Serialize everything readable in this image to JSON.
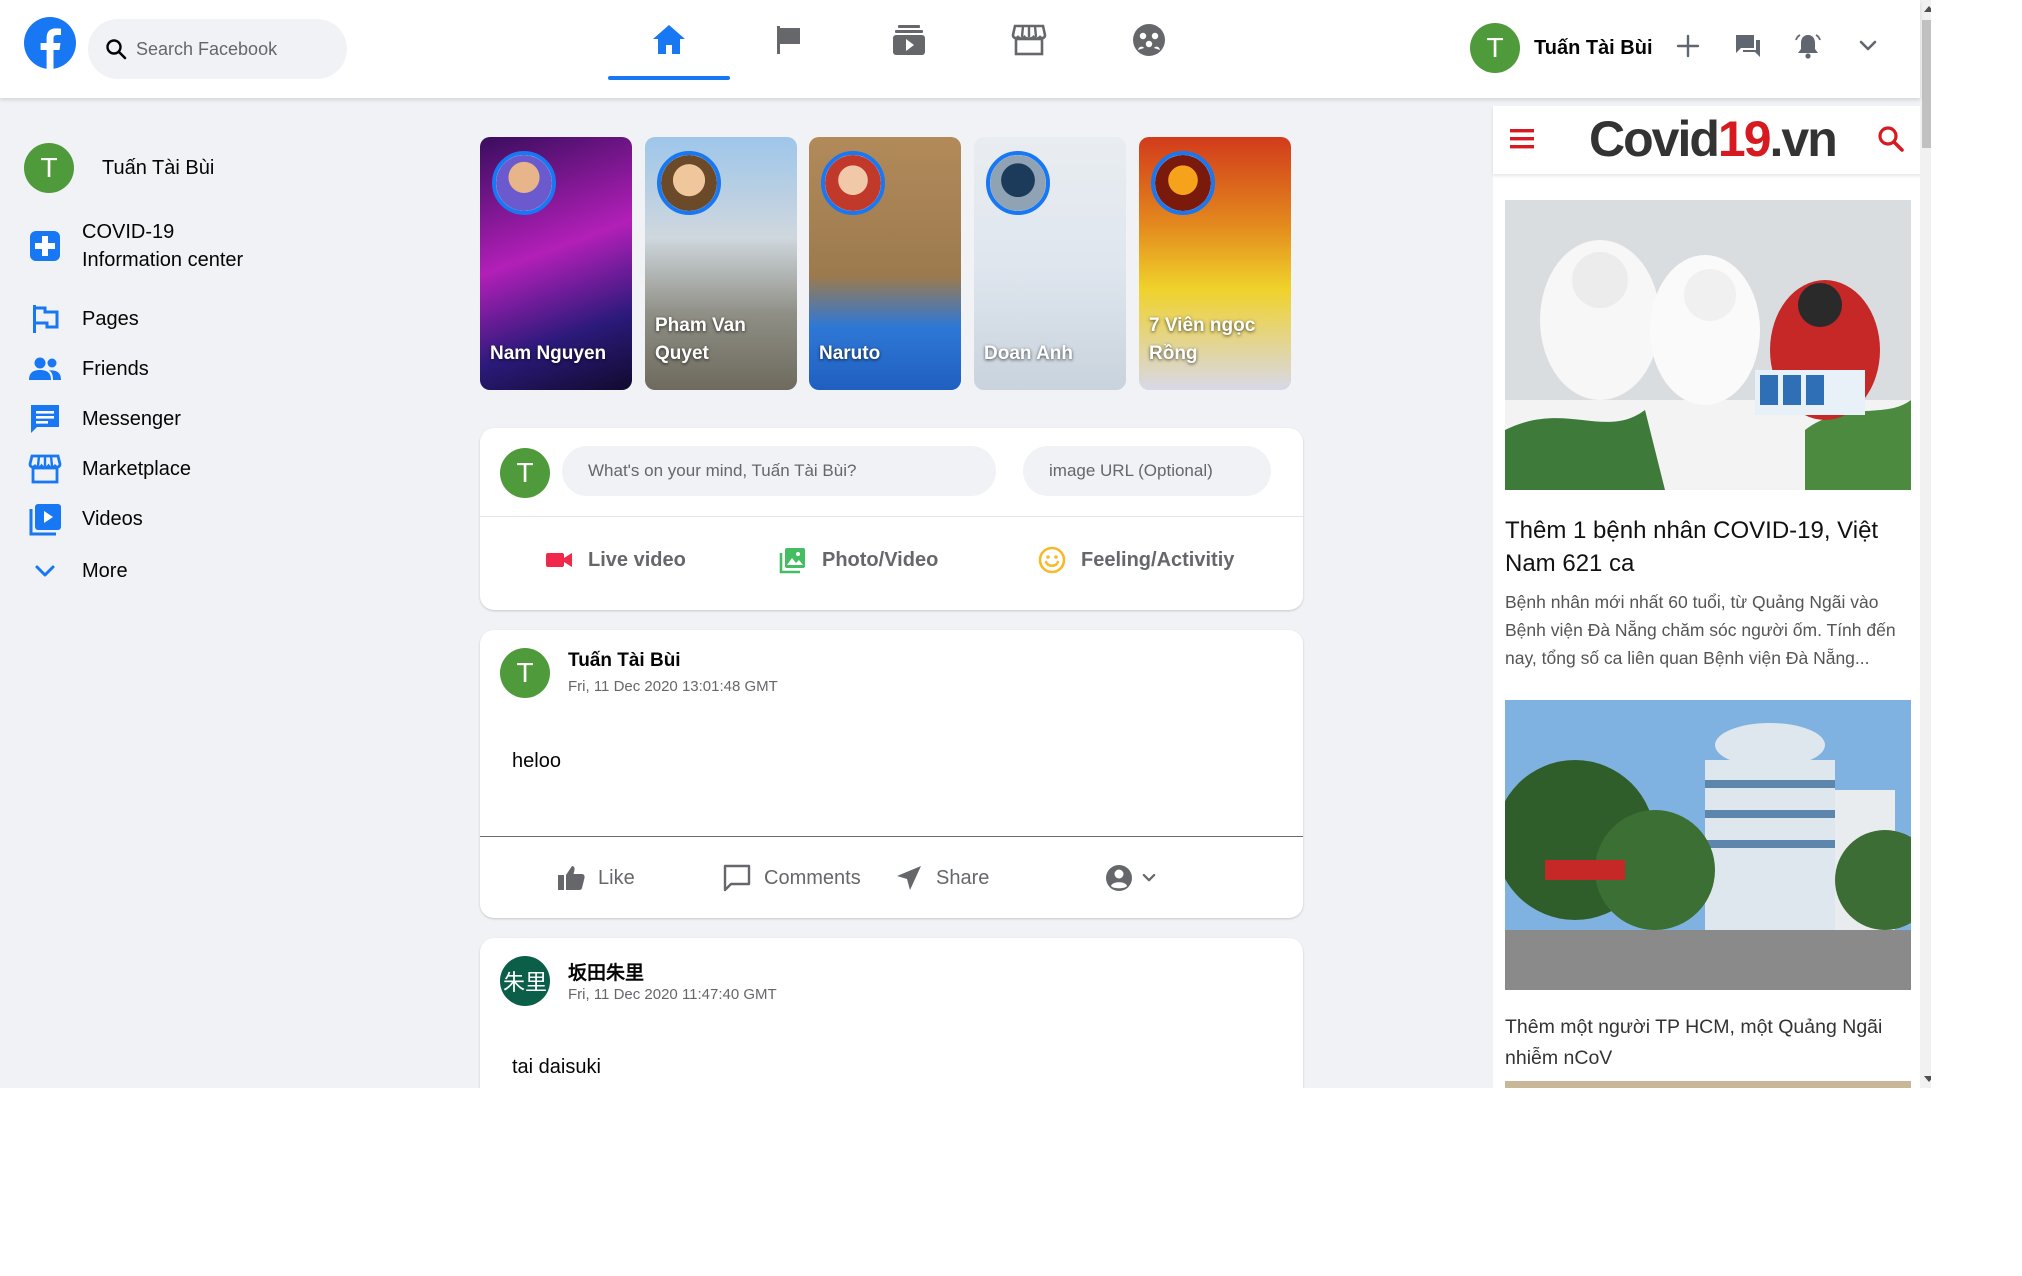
{
  "header": {
    "search_placeholder": "Search Facebook",
    "nav_tabs": [
      "home-icon",
      "flag-icon",
      "watch-icon",
      "marketplace-icon",
      "groups-icon"
    ],
    "user": {
      "initial": "T",
      "name": "Tuấn Tài Bùi"
    },
    "accent": "#1877f2"
  },
  "sidebar": {
    "profile": {
      "initial": "T",
      "name": "Tuấn Tài Bùi"
    },
    "items": [
      {
        "label": "COVID-19",
        "label2": "Information center",
        "icon": "covid-cross-icon"
      },
      {
        "label": "Pages",
        "icon": "flag-icon"
      },
      {
        "label": "Friends",
        "icon": "friends-icon"
      },
      {
        "label": "Messenger",
        "icon": "messenger-icon"
      },
      {
        "label": "Marketplace",
        "icon": "marketplace-icon"
      },
      {
        "label": "Videos",
        "icon": "video-icon"
      },
      {
        "label": "More",
        "icon": "chevron-down-icon"
      }
    ]
  },
  "stories": [
    {
      "name": "Nam Nguyen"
    },
    {
      "name": "Pham Van Quyet"
    },
    {
      "name": "Naruto"
    },
    {
      "name": "Doan Anh"
    },
    {
      "name": "7 Viên ngọc Rồng"
    }
  ],
  "composer": {
    "initial": "T",
    "placeholder": "What's on your mind, Tuấn Tài Bùi?",
    "image_placeholder": "image URL (Optional)",
    "actions": [
      "Live video",
      "Photo/Video",
      "Feeling/Activitiy"
    ]
  },
  "posts": [
    {
      "initial": "T",
      "author": "Tuấn Tài Bùi",
      "time": "Fri, 11 Dec 2020 13:01:48 GMT",
      "text": "heloo",
      "actions": [
        "Like",
        "Comments",
        "Share"
      ]
    },
    {
      "initial": "朱里",
      "author": "坂田朱里",
      "time": "Fri, 11 Dec 2020 11:47:40 GMT",
      "text": "tai daisuki"
    }
  ],
  "news": {
    "logo_a": "Covid",
    "logo_b": "19",
    "logo_c": ".vn",
    "articles": [
      {
        "title": "Thêm 1 bệnh nhân COVID-19, Việt Nam 621 ca",
        "desc": "Bệnh nhân mới nhất 60 tuổi, từ Quảng Ngãi vào Bệnh viện Đà Nẵng chăm sóc người ốm. Tính đến nay, tổng số ca liên quan Bệnh viện Đà Nẵng..."
      },
      {
        "title": "Thêm một người TP HCM, một Quảng Ngãi nhiễm nCoV"
      }
    ]
  }
}
